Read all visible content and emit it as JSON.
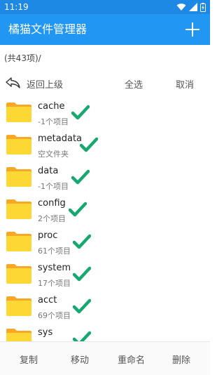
{
  "status_bar": {
    "time": "11:19"
  },
  "app_bar": {
    "title": "橘猫文件管理器"
  },
  "path": "(共43项)/",
  "toolbar": {
    "back_label": "返回上级",
    "select_all_label": "全选",
    "cancel_label": "取消"
  },
  "files": [
    {
      "name": "cache",
      "meta": "-1个项目"
    },
    {
      "name": "metadata",
      "meta": "空文件夹"
    },
    {
      "name": "data",
      "meta": "-1个项目"
    },
    {
      "name": "config",
      "meta": "2个项目"
    },
    {
      "name": "proc",
      "meta": "61个项目"
    },
    {
      "name": "system",
      "meta": "17个项目"
    },
    {
      "name": "acct",
      "meta": "69个项目"
    },
    {
      "name": "sys",
      "meta": ""
    }
  ],
  "bottom_bar": {
    "copy": "复制",
    "move": "移动",
    "rename": "重命名",
    "delete": "删除"
  },
  "colors": {
    "app_bar": "#2196f3",
    "status_bar": "#1e88e5",
    "check": "#17a86f",
    "folder": "#fbc02d"
  }
}
